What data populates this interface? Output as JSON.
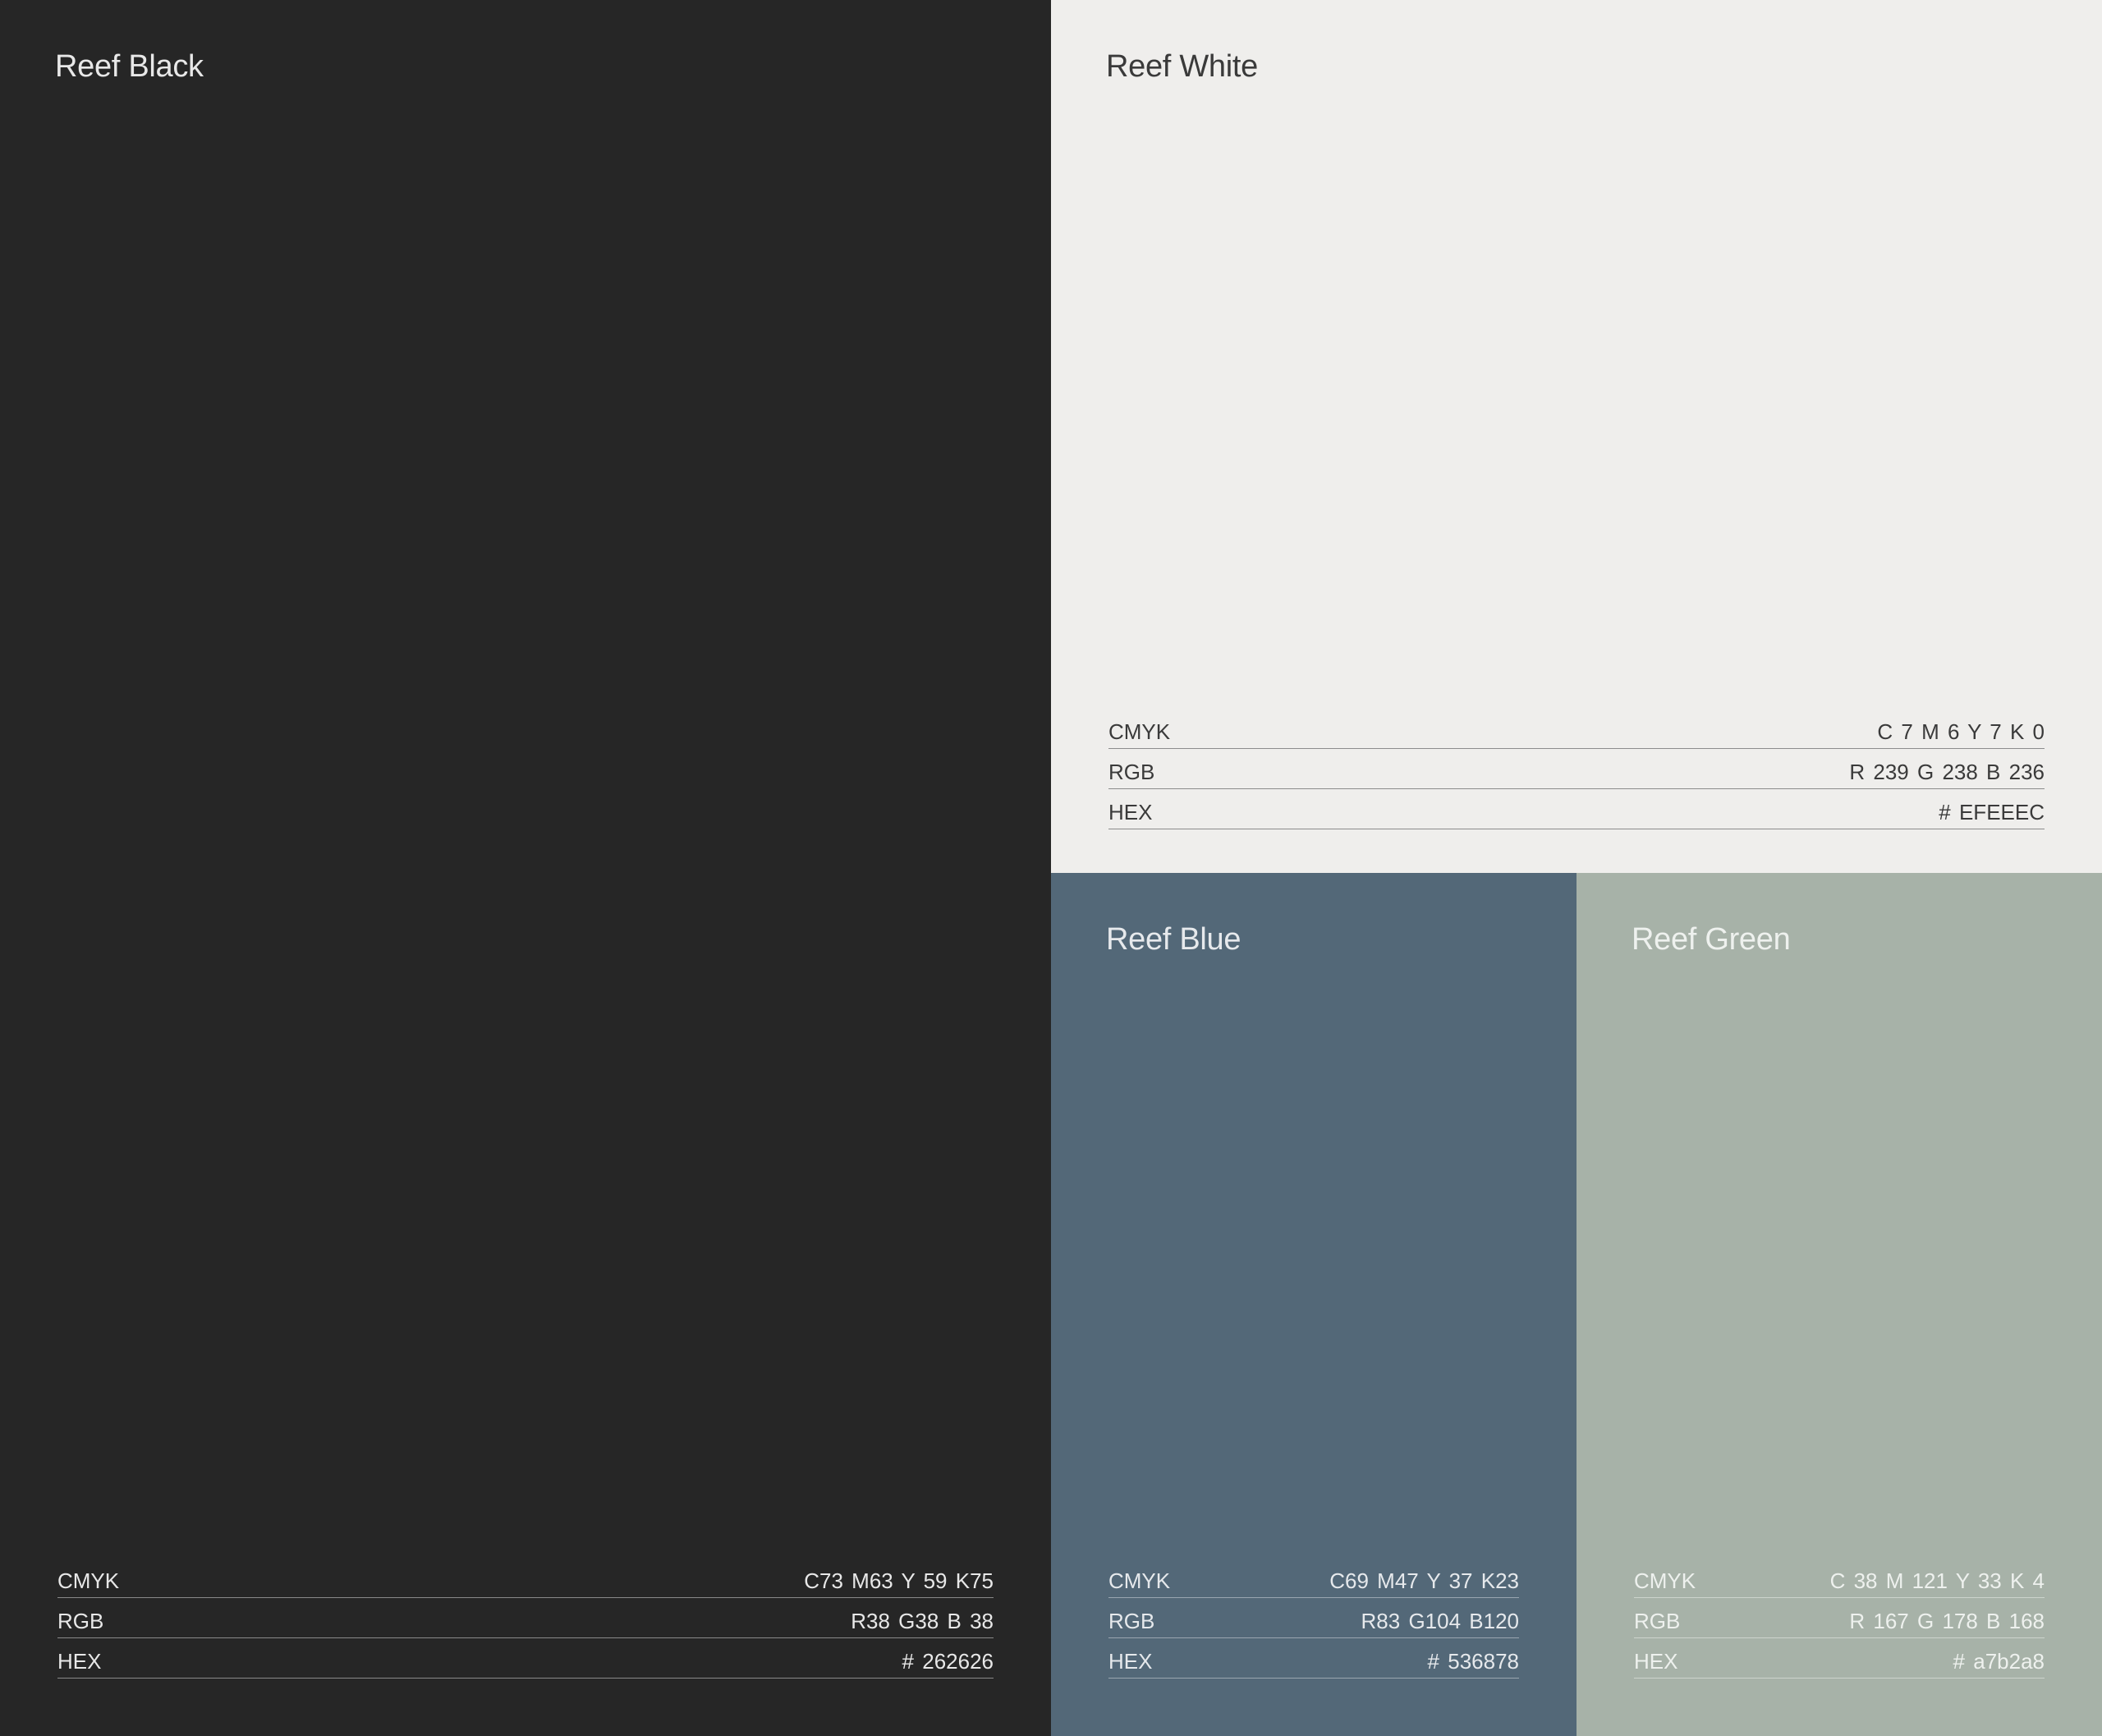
{
  "swatches": {
    "black": {
      "name": "Reef Black",
      "bg": "#262626",
      "text": "#e8e8e8",
      "rule": "#8a8a8a",
      "cmyk_label": "CMYK",
      "cmyk": "C73  M63  Y 59  K75",
      "rgb_label": "RGB",
      "rgb": "R38 G38  B 38",
      "hex_label": "HEX",
      "hex": "# 262626"
    },
    "white": {
      "name": "Reef White",
      "bg": "#efeeec",
      "text": "#3a3a3a",
      "rule": "#8c8c8c",
      "cmyk_label": "CMYK",
      "cmyk": "C 7  M 6  Y 7  K 0",
      "rgb_label": "RGB",
      "rgb": "R 239 G 238  B 236",
      "hex_label": "HEX",
      "hex": "# EFEEEC"
    },
    "blue": {
      "name": "Reef Blue",
      "bg": "#536878",
      "text": "#e6e9ec",
      "rule": "#9aa6b0",
      "cmyk_label": "CMYK",
      "cmyk": "C69  M47  Y 37  K23",
      "rgb_label": "RGB",
      "rgb": "R83 G104  B120",
      "hex_label": "HEX",
      "hex": "# 536878"
    },
    "green": {
      "name": "Reef Green",
      "bg": "#a7b2a8",
      "text": "#eef1ee",
      "rule": "#cdd4cd",
      "cmyk_label": "CMYK",
      "cmyk": "C 38  M 121  Y 33  K 4",
      "rgb_label": "RGB",
      "rgb": "R 167 G 178  B 168",
      "hex_label": "HEX",
      "hex": "# a7b2a8"
    }
  }
}
